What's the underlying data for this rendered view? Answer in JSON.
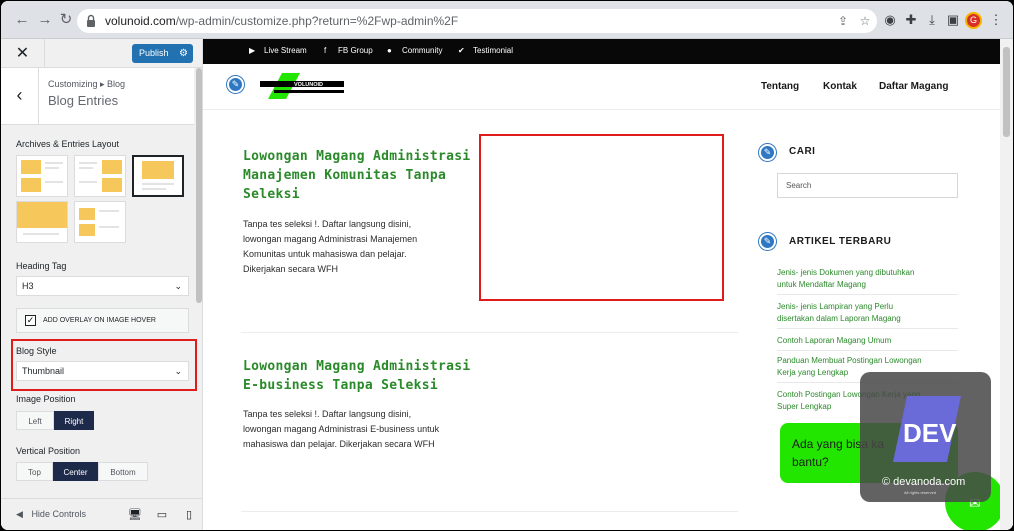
{
  "browser": {
    "url_host": "volunoid.com",
    "url_path": "/wp-admin/customize.php?return=%2Fwp-admin%2F",
    "profile_initial": "G"
  },
  "customizer": {
    "publish_label": "Publish",
    "breadcrumb": "Customizing ▸ Blog",
    "title": "Blog Entries",
    "layout_label": "Archives & Entries Layout",
    "heading_tag_label": "Heading Tag",
    "heading_tag_value": "H3",
    "overlay_label": "ADD OVERLAY ON IMAGE HOVER",
    "overlay_checked": true,
    "blog_style_label": "Blog Style",
    "blog_style_value": "Thumbnail",
    "image_position_label": "Image Position",
    "image_position_options": [
      "Left",
      "Right"
    ],
    "image_position_selected": "Right",
    "vertical_position_label": "Vertical Position",
    "vertical_position_options": [
      "Top",
      "Center",
      "Bottom"
    ],
    "vertical_position_selected": "Center",
    "hide_controls_label": "Hide Controls"
  },
  "site": {
    "topbar_links": [
      "Live Stream",
      "FB Group",
      "Community",
      "Testimonial"
    ],
    "logo_text": "VOLUNOID",
    "menu": [
      "Tentang",
      "Kontak",
      "Daftar Magang"
    ],
    "posts": [
      {
        "title_lines": [
          "Lowongan Magang Administrasi",
          "Manajemen Komunitas Tanpa",
          "Seleksi"
        ],
        "excerpt_lines": [
          "Tanpa tes seleksi !. Daftar langsung disini,",
          "lowongan magang Administrasi Manajemen",
          "Komunitas untuk mahasiswa dan pelajar.",
          "Dikerjakan secara WFH"
        ]
      },
      {
        "title_lines": [
          "Lowongan Magang Administrasi",
          "E-business Tanpa Seleksi"
        ],
        "excerpt_lines": [
          "Tanpa tes seleksi !. Daftar langsung disini,",
          "lowongan magang Administrasi E-business untuk",
          "mahasiswa dan pelajar. Dikerjakan secara WFH"
        ]
      }
    ],
    "search_widget_title": "CARI",
    "search_placeholder": "Search",
    "recent_widget_title": "ARTIKEL TERBARU",
    "recent_articles": [
      [
        "Jenis- jenis Dokumen yang dibutuhkan",
        "untuk Mendaftar Magang"
      ],
      [
        "Jenis- jenis Lampiran yang Perlu",
        "disertakan dalam Laporan Magang"
      ],
      [
        "Contoh Laporan Magang Umum"
      ],
      [
        "Panduan Membuat Postingan Lowongan",
        "Kerja yang Lengkap"
      ],
      [
        "Contoh Postingan Lowongan Kerja yang",
        "Super Lengkap"
      ]
    ],
    "chat_text_lines": [
      "Ada yang bisa ka",
      "bantu?"
    ]
  },
  "watermark": {
    "logo_text": "DEV",
    "site_text": "© devanoda.com",
    "tiny_text": "All rights reserved"
  },
  "colors": {
    "accent_green": "#2a8a2a",
    "chat_green": "#22e600",
    "wp_blue": "#2271b1",
    "highlight_red": "#e01b1b"
  }
}
